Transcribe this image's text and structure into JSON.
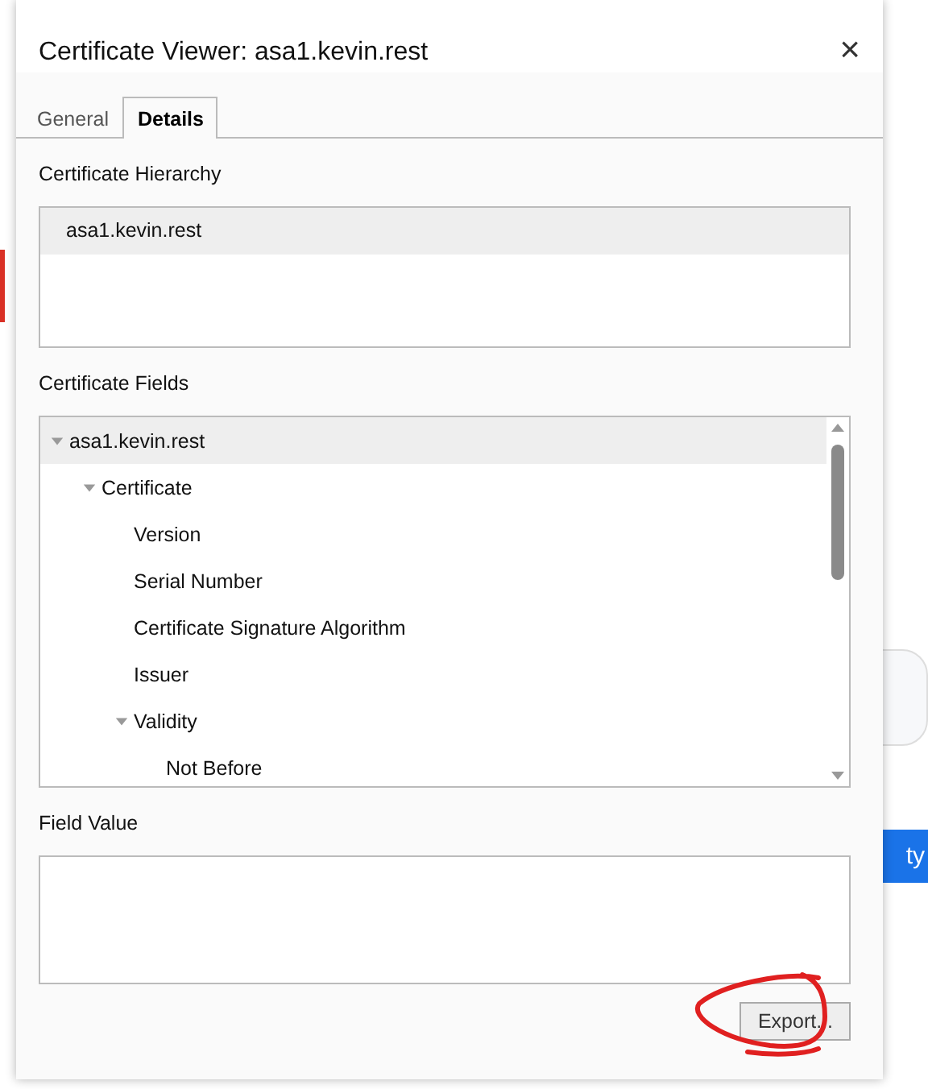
{
  "background": {
    "button_text": "ty"
  },
  "dialog": {
    "title": "Certificate Viewer: asa1.kevin.rest",
    "close": "×",
    "tabs": [
      {
        "label": "General",
        "selected": false
      },
      {
        "label": "Details",
        "selected": true
      }
    ],
    "hierarchy": {
      "label": "Certificate Hierarchy",
      "items": [
        {
          "label": "asa1.kevin.rest",
          "selected": true
        }
      ]
    },
    "fields": {
      "label": "Certificate Fields",
      "tree": [
        {
          "label": "asa1.kevin.rest",
          "selected": true,
          "expanded": true,
          "children": [
            {
              "label": "Certificate",
              "selected": false,
              "expanded": true,
              "children": [
                {
                  "label": "Version",
                  "selected": false
                },
                {
                  "label": "Serial Number",
                  "selected": false
                },
                {
                  "label": "Certificate Signature Algorithm",
                  "selected": false
                },
                {
                  "label": "Issuer",
                  "selected": false
                },
                {
                  "label": "Validity",
                  "selected": false,
                  "expanded": true,
                  "children": [
                    {
                      "label": "Not Before",
                      "selected": false
                    }
                  ]
                }
              ]
            }
          ]
        }
      ]
    },
    "field_value": {
      "label": "Field Value"
    },
    "export_button": "Export..."
  }
}
